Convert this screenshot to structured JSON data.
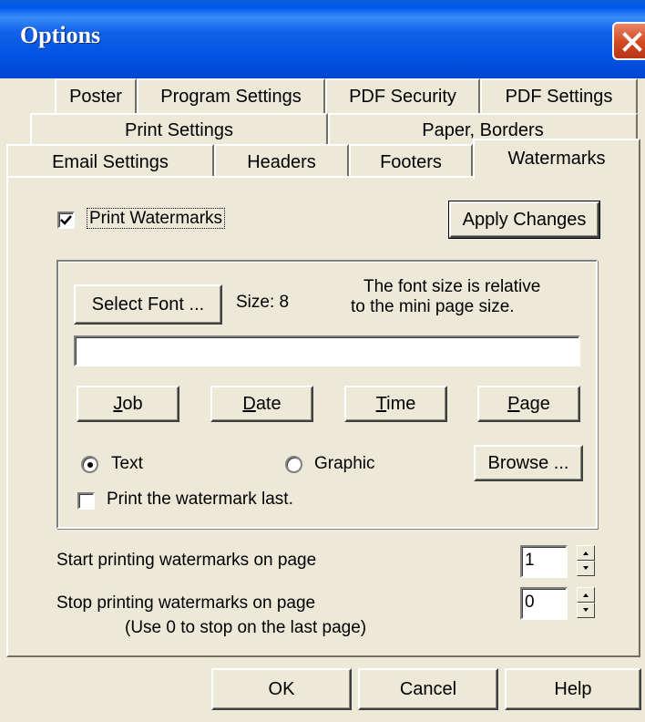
{
  "window": {
    "title": "Options"
  },
  "tabs": {
    "row1": [
      "Poster",
      "Program Settings",
      "PDF Security",
      "PDF Settings"
    ],
    "row2": [
      "Print Settings",
      "Paper, Borders"
    ],
    "row3": [
      "Email Settings",
      "Headers",
      "Footers",
      "Watermarks"
    ],
    "active": "Watermarks"
  },
  "watermarks": {
    "print_watermarks_label": "Print Watermarks",
    "print_watermarks_checked": true,
    "apply_changes_label": "Apply Changes",
    "select_font_label": "Select Font ...",
    "size_label": "Size: 8",
    "font_note_line1": "The font size is relative",
    "font_note_line2": "to the mini page size.",
    "watermark_text_value": "",
    "insert_buttons": {
      "job": {
        "mnemonic": "J",
        "rest": "ob"
      },
      "date": {
        "mnemonic": "D",
        "rest": "ate"
      },
      "time": {
        "mnemonic": "T",
        "rest": "ime"
      },
      "page": {
        "mnemonic": "P",
        "rest": "age"
      }
    },
    "type_text_label": "Text",
    "type_graphic_label": "Graphic",
    "selected_type": "Text",
    "browse_label": "Browse ...",
    "print_last_label": "Print the watermark last.",
    "print_last_checked": false,
    "start_label": "Start printing watermarks on page",
    "start_value": "1",
    "stop_label": "Stop printing watermarks on page",
    "stop_value": "0",
    "stop_hint": "(Use 0 to stop on the last page)"
  },
  "footer_buttons": {
    "ok": "OK",
    "cancel": "Cancel",
    "help": "Help"
  },
  "icons": {
    "close": "close-icon",
    "checkmark": "checkmark-icon",
    "spin_up": "arrow-up-icon",
    "spin_down": "arrow-down-icon"
  },
  "colors": {
    "titlebar": "#0054E3",
    "dialog_bg": "#ECE9D8",
    "close_button": "#D0491F"
  }
}
